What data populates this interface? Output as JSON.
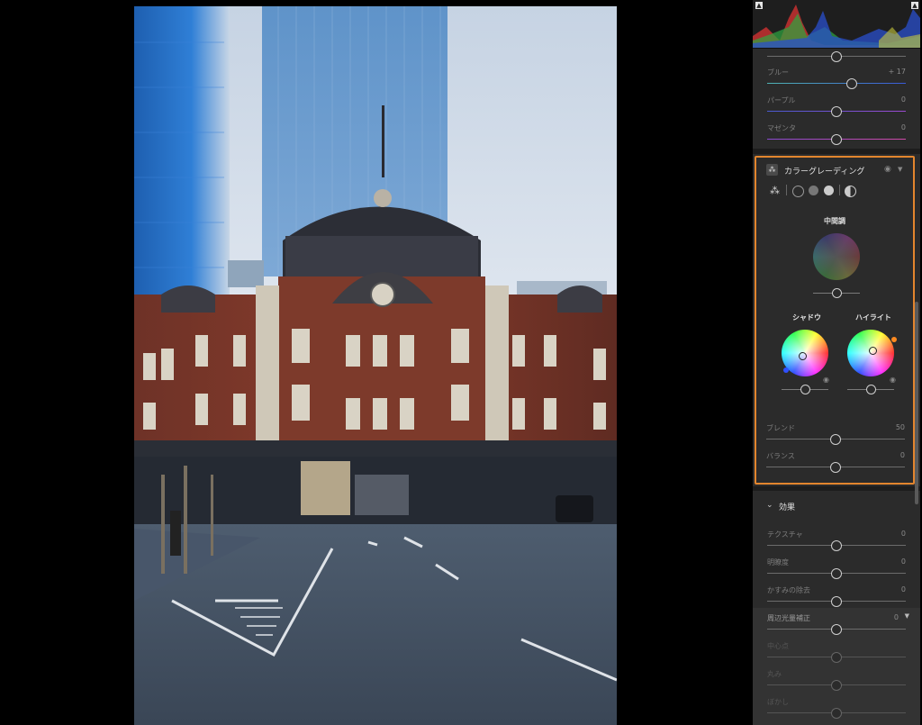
{
  "panel": {
    "hsl_sliders": [
      {
        "label": "",
        "value": "",
        "position": 0.5
      },
      {
        "label": "ブルー",
        "value": "+ 17",
        "position": 0.59
      },
      {
        "label": "パープル",
        "value": "0",
        "position": 0.5
      },
      {
        "label": "マゼンタ",
        "value": "0",
        "position": 0.5
      }
    ],
    "color_grading": {
      "title": "カラーグレーディング",
      "midtones_label": "中間調",
      "shadows_label": "シャドウ",
      "highlights_label": "ハイライト",
      "blend_label": "ブレンド",
      "blend_value": "50",
      "balance_label": "バランス",
      "balance_value": "0"
    },
    "effects": {
      "title": "効果",
      "sliders": [
        {
          "label": "テクスチャ",
          "value": "0",
          "position": 0.5
        },
        {
          "label": "明瞭度",
          "value": "0",
          "position": 0.5
        },
        {
          "label": "かすみの除去",
          "value": "0",
          "position": 0.5
        },
        {
          "label": "周辺光量補正",
          "value": "0",
          "position": 0.5
        },
        {
          "label": "中心点",
          "value": "",
          "position": 0.5
        },
        {
          "label": "丸み",
          "value": "",
          "position": 0.5
        },
        {
          "label": "ぼかし",
          "value": "",
          "position": 0.5
        }
      ]
    }
  },
  "colors": {
    "accent_border": "#e2852e",
    "panel_bg": "#2b2b2b"
  }
}
